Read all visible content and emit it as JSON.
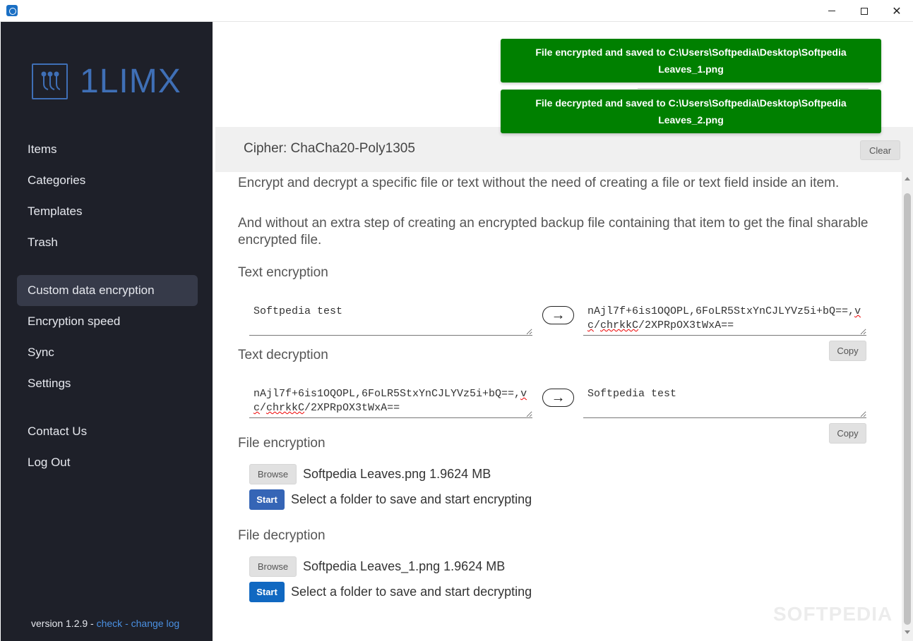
{
  "window": {
    "icon": "app-icon",
    "minimize_icon": "minimize-icon",
    "maximize_icon": "maximize-icon",
    "close_label": "✕"
  },
  "sidebar": {
    "logo_text": "1LIMX",
    "nav_primary": [
      "Items",
      "Categories",
      "Templates",
      "Trash"
    ],
    "nav_secondary": [
      "Custom data encryption",
      "Encryption speed",
      "Sync",
      "Settings"
    ],
    "nav_tertiary": [
      "Contact Us",
      "Log Out"
    ],
    "active_item": "Custom data encryption",
    "version_label": "version 1.2.9 - ",
    "check_link": "check",
    "separator": " - ",
    "changelog_link": "change log"
  },
  "toasts": [
    "File encrypted and saved to C:\\Users\\Softpedia\\Desktop\\Softpedia Leaves_1.png",
    "File decrypted and saved to C:\\Users\\Softpedia\\Desktop\\Softpedia Leaves_2.png"
  ],
  "cipher": {
    "label": "Cipher: ChaCha20-Poly1305",
    "clear_label": "Clear"
  },
  "intro": {
    "p1": "Encrypt and decrypt a specific file or text without the need of creating a file or text field inside an item.",
    "p2": "And without an extra step of creating an encrypted backup file containing that item to get the final sharable encrypted file."
  },
  "text_encryption": {
    "title": "Text encryption",
    "input": "Softpedia test",
    "arrow": "→",
    "output_a": "nAjl7f+6is1OQOPL,6FoLR5StxYnCJLYVz5i+bQ==,",
    "output_b": "vc",
    "output_c": "/",
    "output_d": "chrkkC",
    "output_e": "/2XPRpOX3tWxA==",
    "copy_label": "Copy"
  },
  "text_decryption": {
    "title": "Text decryption",
    "input_a": "nAjl7f+6is1OQOPL,6FoLR5StxYnCJLYVz5i+bQ==,",
    "input_b": "vc",
    "input_c": "/",
    "input_d": "chrkkC",
    "input_e": "/2XPRpOX3tWxA==",
    "arrow": "→",
    "output": "Softpedia test",
    "copy_label": "Copy"
  },
  "file_encryption": {
    "title": "File encryption",
    "browse_label": "Browse",
    "file_info": "Softpedia Leaves.png 1.9624 MB",
    "start_label": "Start",
    "start_hint": "Select a folder to save and start encrypting"
  },
  "file_decryption": {
    "title": "File decryption",
    "browse_label": "Browse",
    "file_info": "Softpedia Leaves_1.png 1.9624 MB",
    "start_label": "Start",
    "start_hint": "Select a folder to save and start decrypting"
  },
  "watermark": "SOFTPEDIA",
  "colors": {
    "sidebar_bg": "#1e2029",
    "brand": "#3f6fb6",
    "toast_success": "#008000",
    "link": "#4a90e2"
  }
}
